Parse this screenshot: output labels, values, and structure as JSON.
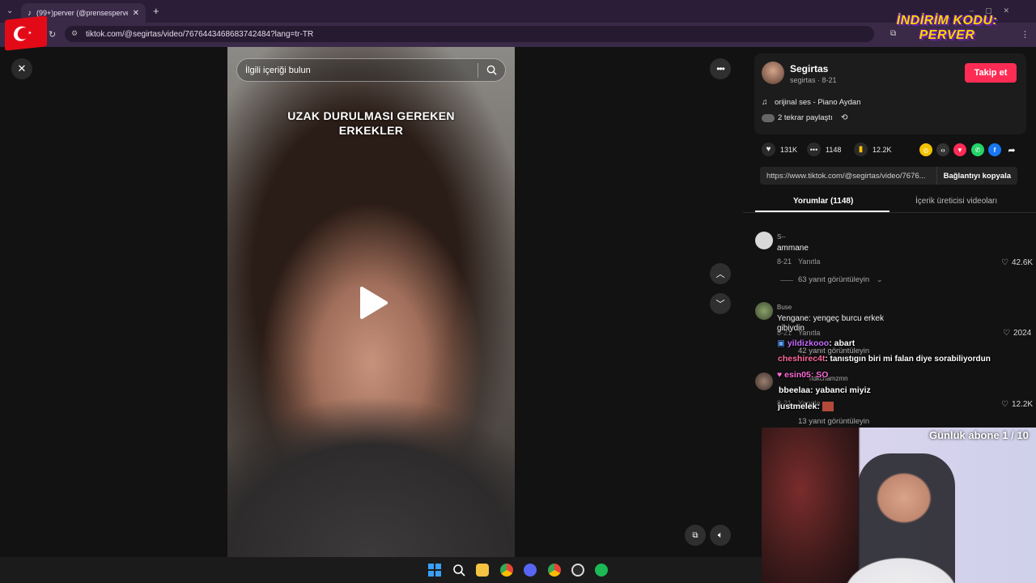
{
  "browser": {
    "tab_title": "(99+)perver (@prensesperver) |",
    "url": "tiktok.com/@segirtas/video/7676443468683742484?lang=tr-TR"
  },
  "promo": {
    "line1": "İNDİRİM KODU:",
    "line2": "PERVER"
  },
  "video": {
    "search_placeholder": "İlgili içeriği bulun",
    "caption": "UZAK DURULMASI GEREKEN ERKEKLER"
  },
  "creator": {
    "name": "Segirtas",
    "handle_date": "segirtas · 8-21",
    "follow_label": "Takip et",
    "sound": "orijinal ses - Piano Aydan",
    "reposts": "2 tekrar paylaştı"
  },
  "stats": {
    "likes": "131K",
    "comments": "1148",
    "saves": "12.2K"
  },
  "share": {
    "link": "https://www.tiktok.com/@segirtas/video/7676...",
    "copy_label": "Bağlantıyı kopyala"
  },
  "tabs": {
    "comments": "Yorumlar (1148)",
    "creator_videos": "İçerik üreticisi videoları"
  },
  "comments": [
    {
      "user": "S--",
      "text": "ammane",
      "date": "8-21",
      "reply": "Yanıtla",
      "likes": "42.6K",
      "replies": "63 yanıt görüntüleyin"
    },
    {
      "user": "Buse",
      "text": "Yengane: yengeç burcu erkek",
      "text2": "gibiydin",
      "date": "8-21",
      "reply": "Yanıtla",
      "likes": "2024",
      "replies": "42 yanıt görüntüleyin"
    },
    {
      "user": "hdkcnamzmn",
      "text": "",
      "date": "8-21",
      "reply": "Yanıtla",
      "likes": "12.2K",
      "replies": "13 yanıt görüntüleyin"
    }
  ],
  "chat": [
    {
      "user": "yildizkooo",
      "msg": ": abart",
      "color": "#c86bff"
    },
    {
      "user": "cheshirec4t",
      "msg": ": tanıstıgın biri mi falan diye sorabiliyordun",
      "color": "#ff6b9a"
    },
    {
      "user": "esin05",
      "msg": ": SO",
      "color": "#ff6bd6"
    },
    {
      "user": "bbeelaa",
      "msg": ": yabanci miyiz",
      "color": "#ffffff"
    },
    {
      "user": "justmelek",
      "msg": ":",
      "color": "#ffffff"
    }
  ],
  "webcam": {
    "subs_label": "Günlük abone 1 / 10"
  },
  "colors": {
    "accent_red": "#fe2c55",
    "panel_bg": "#121212",
    "promo_yellow": "#ffd600"
  }
}
